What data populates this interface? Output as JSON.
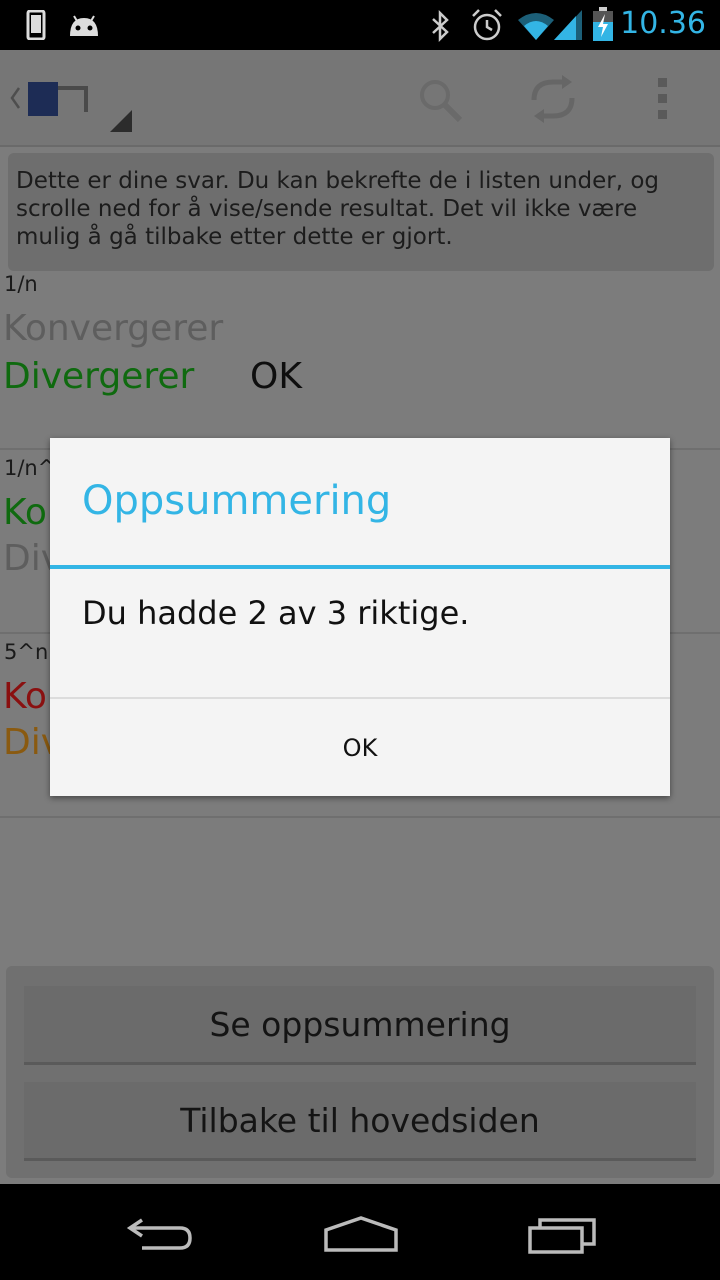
{
  "status_bar": {
    "time": "10.36",
    "icons": [
      "phone-icon",
      "android-icon",
      "bluetooth-icon",
      "alarm-icon",
      "wifi-icon",
      "signal-icon",
      "battery-charging-icon"
    ],
    "accent_color": "#33b5e5"
  },
  "action_bar": {
    "icons": [
      "up-back-icon",
      "app-logo-icon",
      "search-icon",
      "refresh-icon",
      "overflow-menu-icon"
    ]
  },
  "info_text": "Dette er dine svar. Du kan bekrefte de i listen under, og scrolle ned for å vise/sende resultat. Det vil ikke være mulig å gå tilbake etter dette er gjort.",
  "questions": [
    {
      "label": "1/n",
      "option1": "Konvergerer",
      "option2": "Divergerer",
      "result": "OK",
      "option1_color": "#5e5e5e",
      "option2_color": "#0f6a0f"
    },
    {
      "label": "1/n^",
      "option1": "Ko",
      "option2": "Div",
      "result": "",
      "option1_color": "#0f6a0f",
      "option2_color": "#5e5e5e"
    },
    {
      "label": "5^n",
      "option1": "Ko",
      "option2": "Div",
      "result": "",
      "option1_color": "#8a1010",
      "option2_color": "#8a5a10"
    }
  ],
  "buttons": {
    "summary": "Se oppsummering",
    "back_home": "Tilbake til hovedsiden"
  },
  "dialog": {
    "title": "Oppsummering",
    "message": "Du hadde 2 av 3 riktige.",
    "ok": "OK"
  },
  "nav_bar": {
    "icons": [
      "back-icon",
      "home-icon",
      "recent-apps-icon"
    ]
  }
}
